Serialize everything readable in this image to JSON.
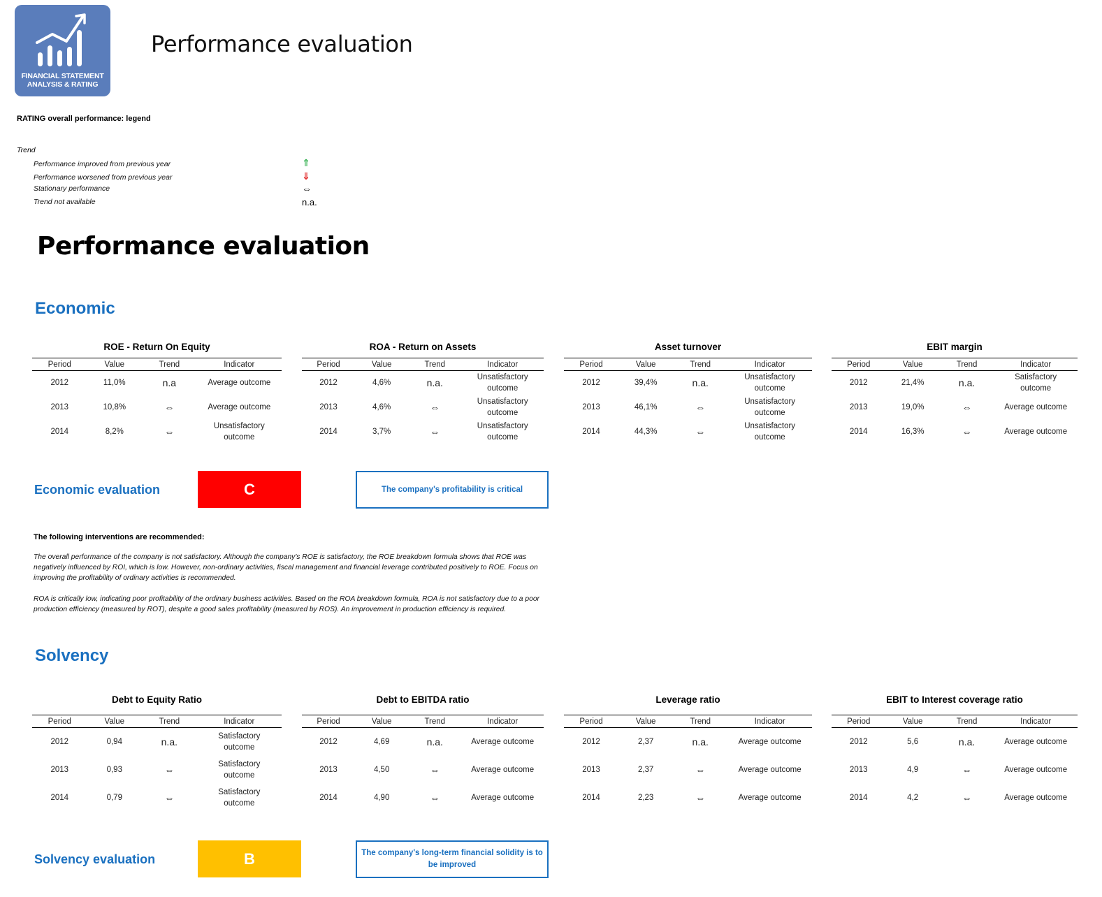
{
  "header": {
    "logo_text_line1": "FINANCIAL STATEMENT",
    "logo_text_line2": "ANALYSIS & RATING",
    "title": "Performance evaluation"
  },
  "legend": {
    "title": "RATING overall performance: legend",
    "heading": "Trend",
    "items": [
      {
        "label": "Performance improved from previous year",
        "symbol": "⇑",
        "icon": "arrow-up-icon",
        "color": "#2fae4c"
      },
      {
        "label": "Performance worsened from previous year",
        "symbol": "⇓",
        "icon": "arrow-down-icon",
        "color": "#e01e1e"
      },
      {
        "label": "Stationary performance",
        "symbol": "⇔",
        "icon": "arrow-left-right-icon",
        "color": "#000000"
      },
      {
        "label": "Trend not available",
        "symbol": "n.a.",
        "icon": "not-available-text",
        "color": "#000000"
      }
    ]
  },
  "main_title": "Performance evaluation",
  "columns": [
    "Period",
    "Value",
    "Trend",
    "Indicator"
  ],
  "economic": {
    "title": "Economic",
    "metrics": [
      {
        "title": "ROE - Return On Equity",
        "rows": [
          {
            "period": "2012",
            "value": "11,0%",
            "trend": "n.a",
            "indicator": "Average outcome"
          },
          {
            "period": "2013",
            "value": "10,8%",
            "trend": "⇔",
            "indicator": "Average outcome"
          },
          {
            "period": "2014",
            "value": "8,2%",
            "trend": "⇔",
            "indicator": "Unsatisfactory outcome"
          }
        ]
      },
      {
        "title": "ROA - Return on Assets",
        "rows": [
          {
            "period": "2012",
            "value": "4,6%",
            "trend": "n.a.",
            "indicator": "Unsatisfactory outcome"
          },
          {
            "period": "2013",
            "value": "4,6%",
            "trend": "⇔",
            "indicator": "Unsatisfactory outcome"
          },
          {
            "period": "2014",
            "value": "3,7%",
            "trend": "⇔",
            "indicator": "Unsatisfactory outcome"
          }
        ]
      },
      {
        "title": "Asset turnover",
        "rows": [
          {
            "period": "2012",
            "value": "39,4%",
            "trend": "n.a.",
            "indicator": "Unsatisfactory outcome"
          },
          {
            "period": "2013",
            "value": "46,1%",
            "trend": "⇔",
            "indicator": "Unsatisfactory outcome"
          },
          {
            "period": "2014",
            "value": "44,3%",
            "trend": "⇔",
            "indicator": "Unsatisfactory outcome"
          }
        ]
      },
      {
        "title": "EBIT margin",
        "rows": [
          {
            "period": "2012",
            "value": "21,4%",
            "trend": "n.a.",
            "indicator": "Satisfactory outcome"
          },
          {
            "period": "2013",
            "value": "19,0%",
            "trend": "⇔",
            "indicator": "Average outcome"
          },
          {
            "period": "2014",
            "value": "16,3%",
            "trend": "⇔",
            "indicator": "Average outcome"
          }
        ]
      }
    ],
    "evaluation": {
      "label": "Economic evaluation",
      "grade": "C",
      "grade_color": "#ff0000",
      "message": "The company's profitability is critical"
    },
    "interventions_title": "The following interventions are recommended:",
    "interventions": [
      "The overall performance of the company is not satisfactory. Although the company's ROE is satisfactory, the ROE breakdown formula shows that ROE was negatively influenced by ROI, which is low. However, non-ordinary activities, fiscal management and financial leverage contributed positively to ROE. Focus on improving the profitability of ordinary activities is recommended.",
      "ROA is critically low, indicating poor profitability of the ordinary business activities. Based on the ROA breakdown formula, ROA is not satisfactory due to a poor production efficiency (measured by ROT), despite a good sales profitability (measured by ROS). An improvement in production efficiency is required."
    ]
  },
  "solvency": {
    "title": "Solvency",
    "metrics": [
      {
        "title": "Debt to Equity Ratio",
        "rows": [
          {
            "period": "2012",
            "value": "0,94",
            "trend": "n.a.",
            "indicator": "Satisfactory outcome"
          },
          {
            "period": "2013",
            "value": "0,93",
            "trend": "⇔",
            "indicator": "Satisfactory outcome"
          },
          {
            "period": "2014",
            "value": "0,79",
            "trend": "⇔",
            "indicator": "Satisfactory outcome"
          }
        ]
      },
      {
        "title": "Debt to EBITDA ratio",
        "rows": [
          {
            "period": "2012",
            "value": "4,69",
            "trend": "n.a.",
            "indicator": "Average outcome"
          },
          {
            "period": "2013",
            "value": "4,50",
            "trend": "⇔",
            "indicator": "Average outcome"
          },
          {
            "period": "2014",
            "value": "4,90",
            "trend": "⇔",
            "indicator": "Average outcome"
          }
        ]
      },
      {
        "title": "Leverage ratio",
        "rows": [
          {
            "period": "2012",
            "value": "2,37",
            "trend": "n.a.",
            "indicator": "Average outcome"
          },
          {
            "period": "2013",
            "value": "2,37",
            "trend": "⇔",
            "indicator": "Average outcome"
          },
          {
            "period": "2014",
            "value": "2,23",
            "trend": "⇔",
            "indicator": "Average outcome"
          }
        ]
      },
      {
        "title": "EBIT to Interest coverage ratio",
        "rows": [
          {
            "period": "2012",
            "value": "5,6",
            "trend": "n.a.",
            "indicator": "Average outcome"
          },
          {
            "period": "2013",
            "value": "4,9",
            "trend": "⇔",
            "indicator": "Average outcome"
          },
          {
            "period": "2014",
            "value": "4,2",
            "trend": "⇔",
            "indicator": "Average outcome"
          }
        ]
      }
    ],
    "evaluation": {
      "label": "Solvency evaluation",
      "grade": "B",
      "grade_color": "#ffc000",
      "message": "The company's long-term financial solidity is to be improved"
    }
  }
}
